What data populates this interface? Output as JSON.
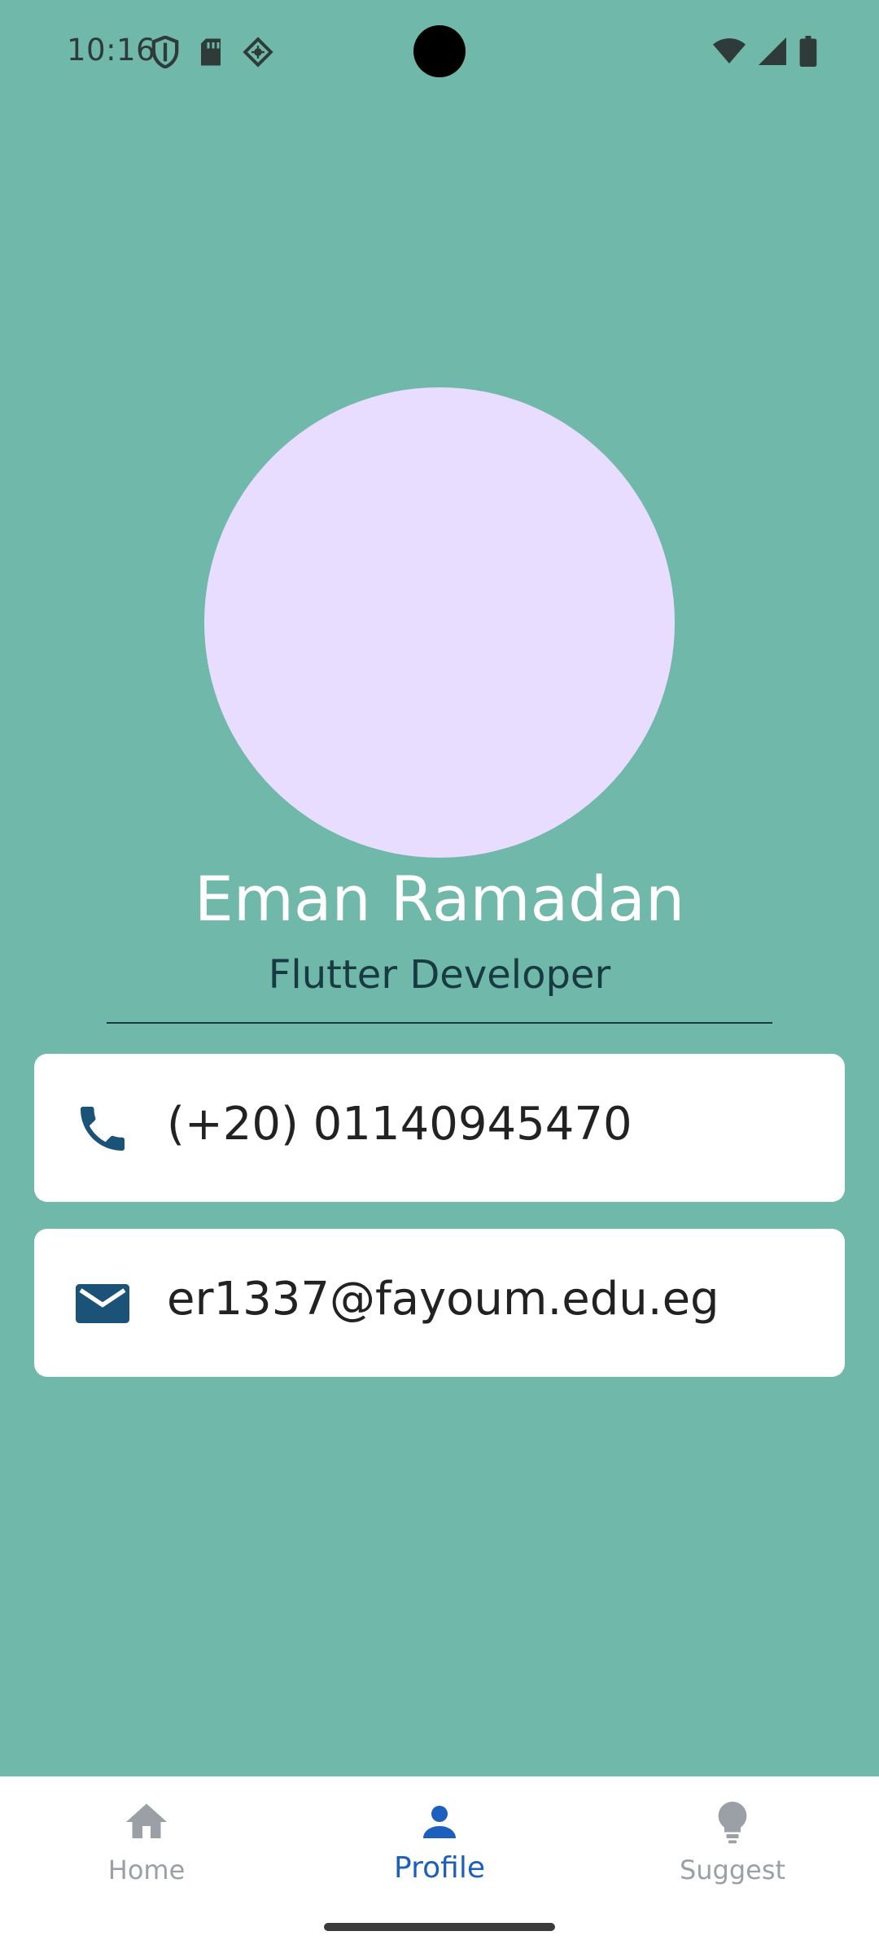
{
  "status_bar": {
    "time": "10:16",
    "left_icons": [
      "shield-icon",
      "sd-card-icon",
      "vpn-key-icon"
    ],
    "right_icons": [
      "wifi-icon",
      "signal-icon",
      "battery-icon"
    ]
  },
  "profile": {
    "name": "Eman Ramadan",
    "role": "Flutter Developer",
    "avatar_color": "#e9ddff"
  },
  "contacts": [
    {
      "icon": "phone-icon",
      "text": "(+20) 01140945470"
    },
    {
      "icon": "email-icon",
      "text": "er1337@fayoum.edu.eg"
    }
  ],
  "bottom_nav": {
    "items": [
      {
        "label": "Home",
        "icon": "home-icon",
        "active": false
      },
      {
        "label": "Profile",
        "icon": "person-icon",
        "active": true
      },
      {
        "label": "Suggest",
        "icon": "lightbulb-icon",
        "active": false
      }
    ],
    "active_color": "#1d5fbd",
    "inactive_color": "#9aa0a6"
  },
  "colors": {
    "background": "#70b8a9",
    "icon_accent": "#1b5278"
  }
}
